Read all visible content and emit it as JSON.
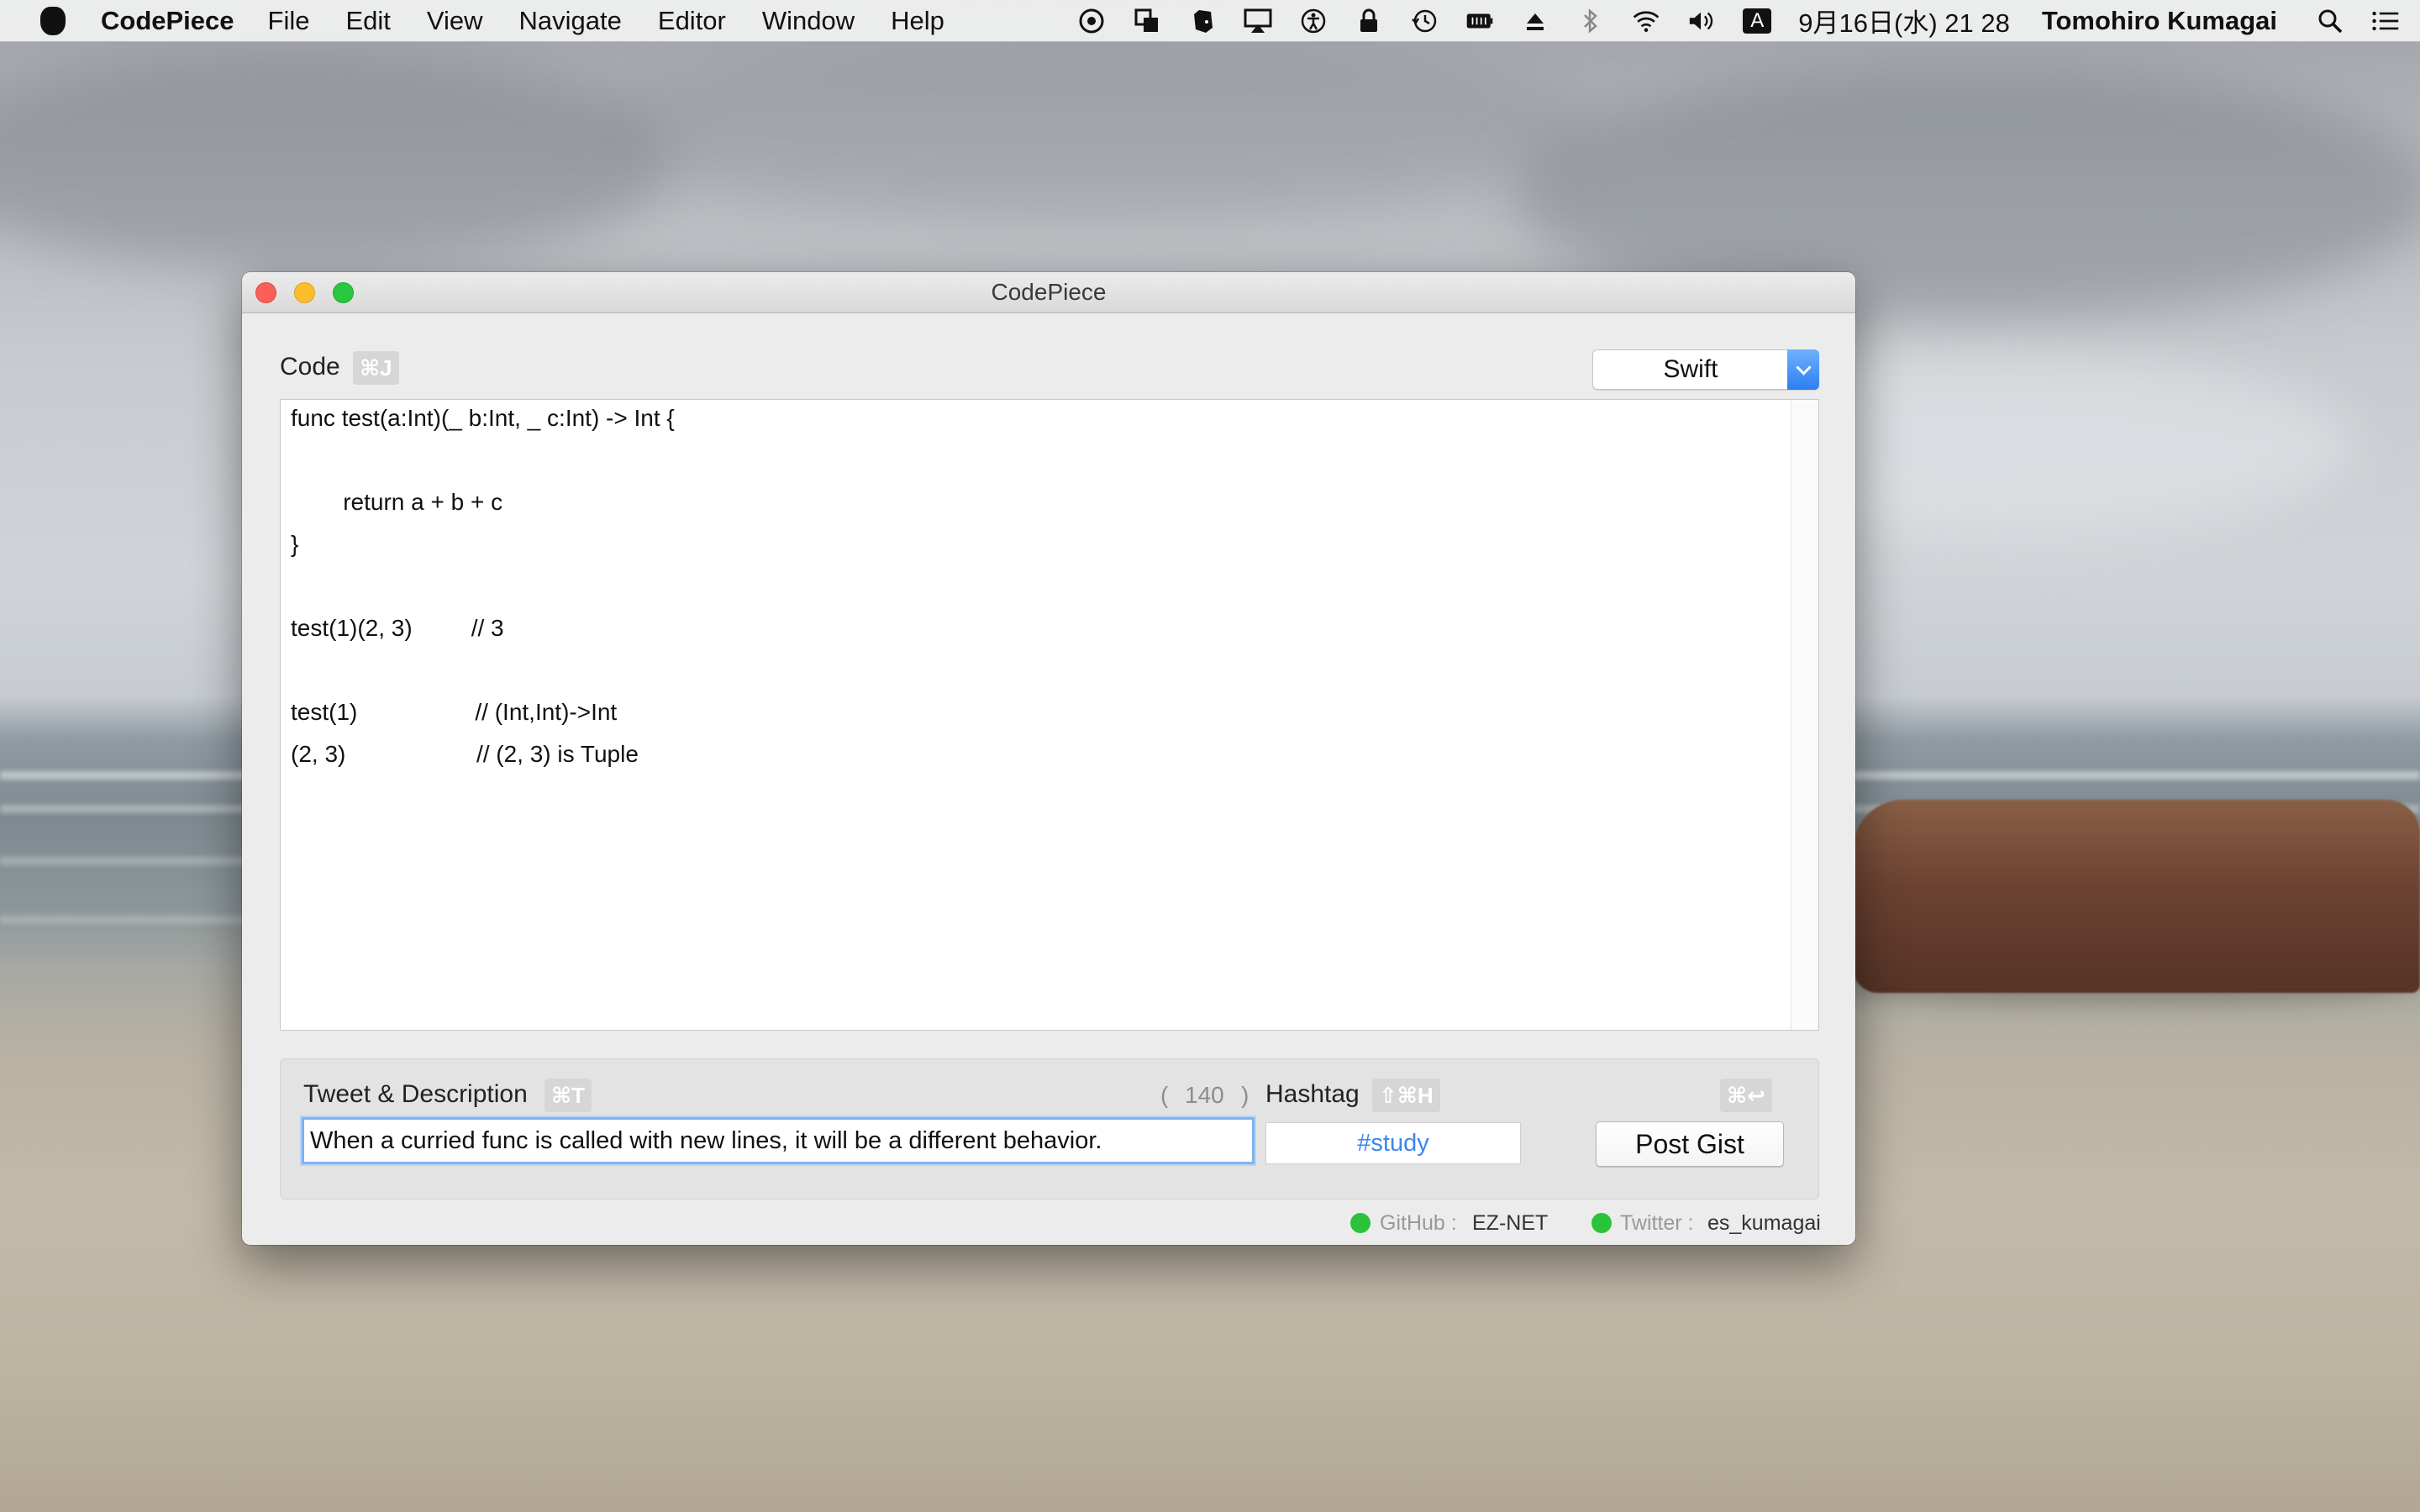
{
  "menubar": {
    "app_name": "CodePiece",
    "items": [
      "File",
      "Edit",
      "View",
      "Navigate",
      "Editor",
      "Window",
      "Help"
    ],
    "clock": "9月16日(水)  21 28",
    "user": "Tomohiro Kumagai",
    "input_source": "A"
  },
  "window": {
    "title": "CodePiece"
  },
  "code_section": {
    "label": "Code",
    "shortcut": "⌘J",
    "language": "Swift",
    "lines": [
      "func test(a:Int)(_ b:Int, _ c:Int) -> Int {",
      "",
      "        return a + b + c",
      "}",
      "",
      "test(1)(2, 3)         // 3",
      "",
      "test(1)                  // (Int,Int)->Int",
      "(2, 3)                    // (2, 3) is Tuple"
    ]
  },
  "tweet_section": {
    "label": "Tweet & Description",
    "shortcut": "⌘T",
    "count_open": "(",
    "count": "140",
    "count_close": ")",
    "text": "When a curried func is called with new lines, it will be a different behavior."
  },
  "hashtag_section": {
    "label": "Hashtag",
    "shortcut": "⇧⌘H",
    "value": "#study"
  },
  "post": {
    "shortcut": "⌘↩",
    "label": "Post Gist"
  },
  "status": {
    "github_key": "GitHub :",
    "github_value": "EZ-NET",
    "twitter_key": "Twitter :",
    "twitter_value": "es_kumagai",
    "ok_color": "#2ac33a"
  }
}
